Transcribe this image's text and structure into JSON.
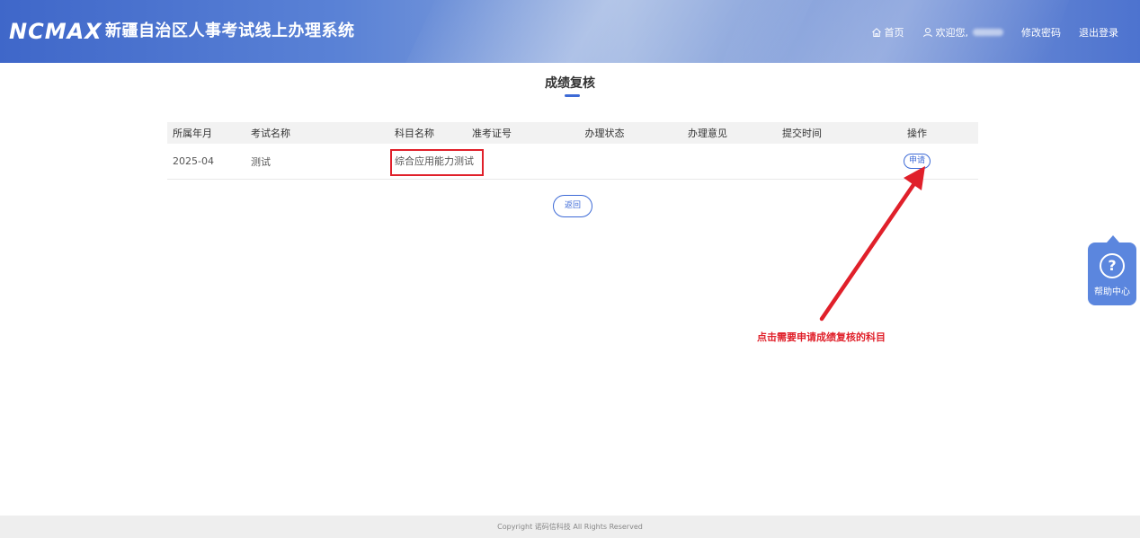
{
  "header": {
    "logo": "NCMAX",
    "title": "新疆自治区人事考试线上办理系统",
    "nav": {
      "home": "首页",
      "welcome": "欢迎您,",
      "change_password": "修改密码",
      "logout": "退出登录"
    }
  },
  "page": {
    "title": "成绩复核"
  },
  "table": {
    "headers": [
      "所属年月",
      "考试名称",
      "科目名称",
      "准考证号",
      "办理状态",
      "办理意见",
      "提交时间",
      "操作"
    ],
    "rows": [
      {
        "month": "2025-04",
        "exam": "测试",
        "subject": "综合应用能力测试",
        "ticket": "",
        "status": "",
        "opinion": "",
        "submit_time": "",
        "action": "申请"
      }
    ]
  },
  "back_button": "返回",
  "annotation": "点击需要申请成绩复核的科目",
  "help": {
    "icon": "?",
    "label": "帮助中心"
  },
  "footer": "Copyright 诺码信科技 All Rights Reserved",
  "colors": {
    "accent": "#3d6ad6",
    "annotation_red": "#e0202a",
    "help_bg": "#5b86de"
  }
}
